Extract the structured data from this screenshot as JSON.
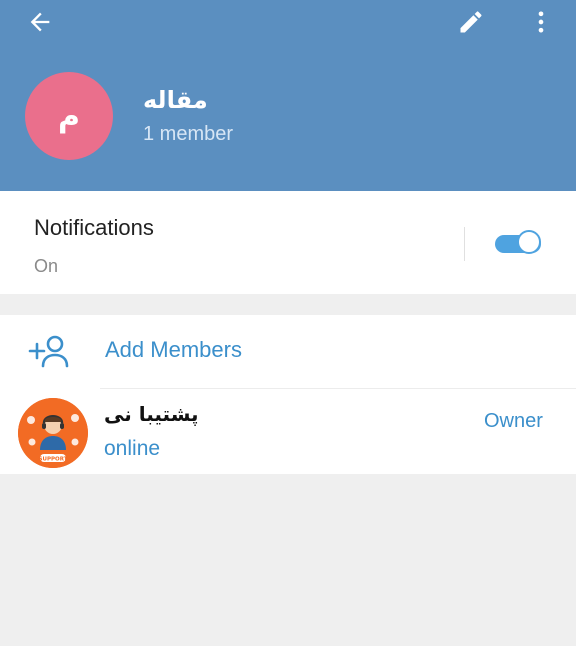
{
  "header": {
    "back_icon": "arrow-left-icon",
    "edit_icon": "pencil-icon",
    "more_icon": "more-vertical-icon",
    "background_color": "#5b8fc0"
  },
  "group": {
    "avatar_letter": "م",
    "avatar_color": "#ea6f8c",
    "name": "مقاله",
    "member_count": "1 member"
  },
  "notifications": {
    "title": "Notifications",
    "status": "On",
    "enabled": true
  },
  "members": {
    "add_label": "Add Members",
    "add_icon": "add-user-icon",
    "list": [
      {
        "name": "پشتیبا    نی",
        "status": "online",
        "role": "Owner",
        "avatar_color": "#f26b24",
        "avatar_text": "SUPPORT"
      }
    ]
  },
  "colors": {
    "accent": "#3b8fcb",
    "toggle_on": "#4fa3e0"
  }
}
